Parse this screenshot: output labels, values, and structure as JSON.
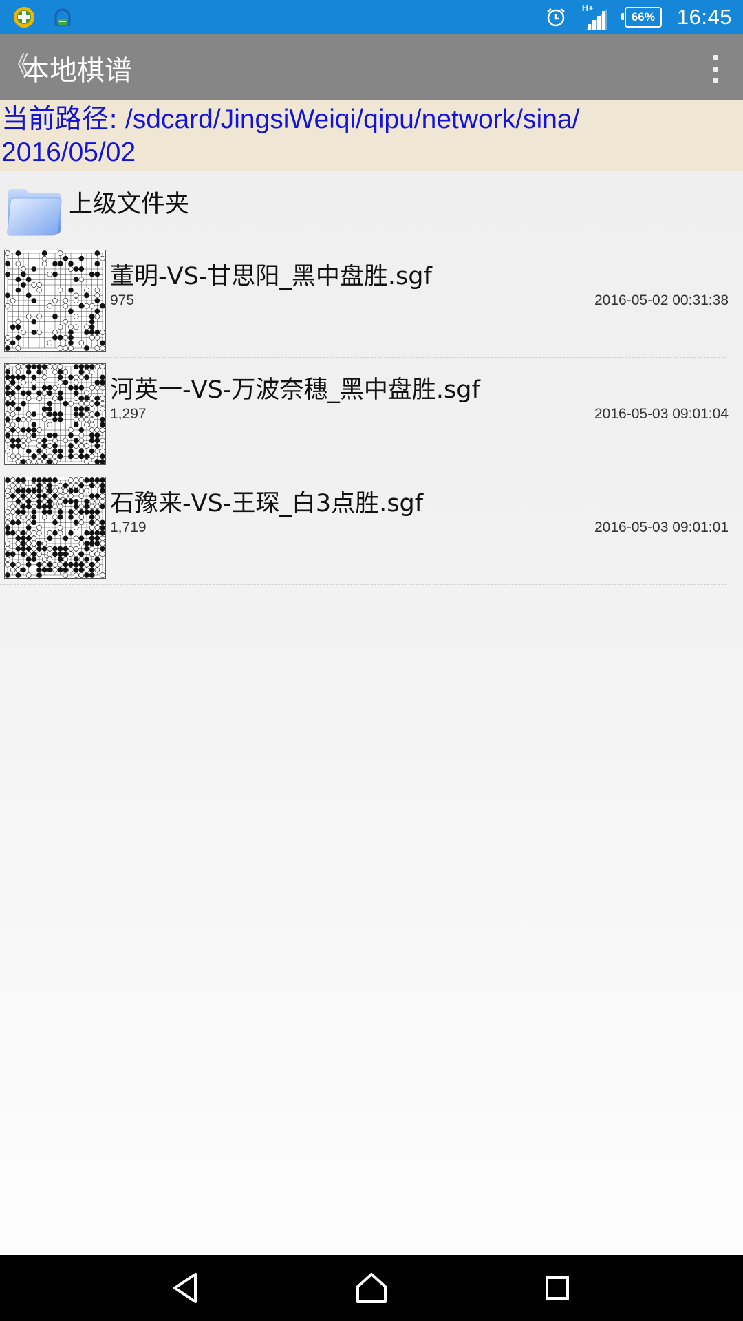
{
  "status_bar": {
    "time": "16:45",
    "battery": "66%",
    "network": "H+",
    "bg_color": "#1586d8"
  },
  "action_bar": {
    "back_glyph": "《",
    "title": "本地棋谱",
    "bg_color": "#868686"
  },
  "path_bar": {
    "label": "当前路径:",
    "path_line1": " /sdcard/JingsiWeiqi/qipu/network/sina/",
    "path_line2": "2016/05/02",
    "text_color": "#1414d8",
    "bg_color": "#efe7d4"
  },
  "parent_folder": {
    "label": "上级文件夹",
    "icon": "folder-icon"
  },
  "files": [
    {
      "name": "董明-VS-甘思阳_黑中盘胜.sgf",
      "size": "975",
      "date": "2016-05-02 00:31:38"
    },
    {
      "name": "河英一-VS-万波奈穗_黑中盘胜.sgf",
      "size": "1,297",
      "date": "2016-05-03 09:01:04"
    },
    {
      "name": "石豫来-VS-王琛_白3点胜.sgf",
      "size": "1,719",
      "date": "2016-05-03 09:01:01"
    }
  ],
  "nav_bar": {
    "back": "back-icon",
    "home": "home-icon",
    "recents": "recents-icon"
  }
}
